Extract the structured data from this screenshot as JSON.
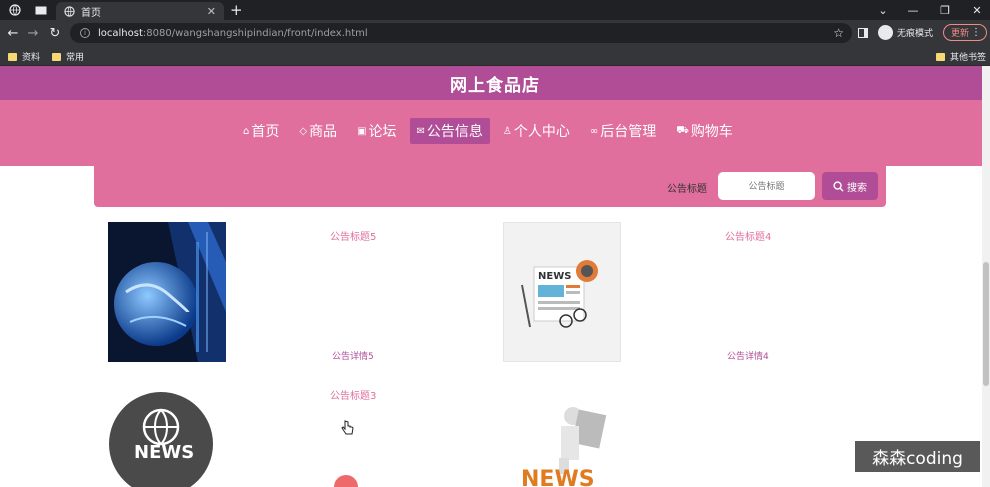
{
  "browser": {
    "active_tab_title": "首页",
    "url_host": "localhost",
    "url_path": ":8080/wangshangshipindian/front/index.html",
    "incognito_label": "无痕模式",
    "update_label": "更新",
    "bookmarks": [
      "资料",
      "常用"
    ],
    "other_bookmarks": "其他书签"
  },
  "site": {
    "title": "网上食品店",
    "nav": [
      {
        "label": "首页",
        "icon": "home-icon",
        "active": false
      },
      {
        "label": "商品",
        "icon": "tag-icon",
        "active": false
      },
      {
        "label": "论坛",
        "icon": "forum-icon",
        "active": false
      },
      {
        "label": "公告信息",
        "icon": "mail-icon",
        "active": true
      },
      {
        "label": "个人中心",
        "icon": "user-icon",
        "active": false
      },
      {
        "label": "后台管理",
        "icon": "link-icon",
        "active": false
      },
      {
        "label": "购物车",
        "icon": "cart-icon",
        "active": false
      }
    ]
  },
  "search": {
    "label": "公告标题",
    "placeholder": "公告标题",
    "button_label": "搜索"
  },
  "notices": [
    {
      "title": "公告标题5",
      "detail": "公告详情5",
      "image": "globe-tech-image"
    },
    {
      "title": "公告标题4",
      "detail": "公告详情4",
      "image": "news-paper-image"
    },
    {
      "title": "公告标题3",
      "detail": "",
      "image": "news-globe-image"
    },
    {
      "title": "",
      "detail": "",
      "image": "news-figure-image"
    }
  ],
  "watermark": "森森coding",
  "colors": {
    "brand_dark": "#b14d97",
    "brand_light": "#e06f9d"
  }
}
